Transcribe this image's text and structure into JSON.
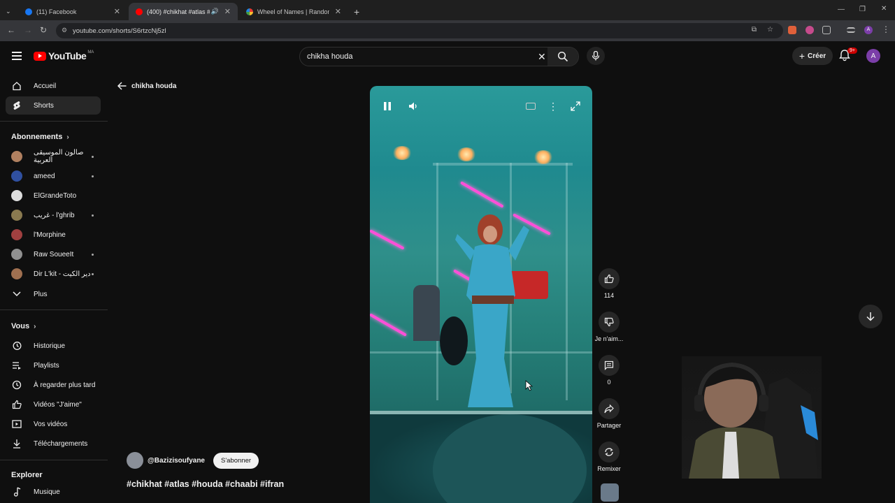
{
  "browser": {
    "tabs": [
      {
        "title": "(11) Facebook",
        "color": "#1877f2",
        "active": false
      },
      {
        "title": "(400) #chikhat #atlas #houd",
        "color": "#ff0000",
        "active": true
      },
      {
        "title": "Wheel of Names | Random nam",
        "color": "#4caf50",
        "active": false
      }
    ],
    "url": "youtube.com/shorts/S6rtzcNj5zl"
  },
  "header": {
    "logo_text": "YouTube",
    "country_code": "MA",
    "search_value": "chikha houda",
    "create_label": "Créer",
    "notif_count": "9+",
    "avatar_letter": "A"
  },
  "sidebar": {
    "main": [
      {
        "label": "Accueil",
        "icon": "home-icon"
      },
      {
        "label": "Shorts",
        "icon": "shorts-icon"
      }
    ],
    "subscriptions_title": "Abonnements",
    "subscriptions": [
      {
        "label": "صالون الموسيقى العربية",
        "color": "#b08060",
        "dot": true
      },
      {
        "label": "ameed",
        "color": "#3050a0",
        "dot": true
      },
      {
        "label": "ElGrandeToto",
        "color": "#dddddd",
        "dot": false
      },
      {
        "label": "غريب - l'ghrib",
        "color": "#8a7a50",
        "dot": true
      },
      {
        "label": "l'Morphine",
        "color": "#a04040",
        "dot": false
      },
      {
        "label": "Raw SoueeIt",
        "color": "#909090",
        "dot": true
      },
      {
        "label": "Dir L'kit - دير الكيت",
        "color": "#a07050",
        "dot": true
      }
    ],
    "more_label": "Plus",
    "you_title": "Vous",
    "you_items": [
      {
        "label": "Historique",
        "icon": "history-icon"
      },
      {
        "label": "Playlists",
        "icon": "playlists-icon"
      },
      {
        "label": "À regarder plus tard",
        "icon": "watch-later-icon"
      },
      {
        "label": "Vidéos \"J'aime\"",
        "icon": "liked-videos-icon"
      },
      {
        "label": "Vos vidéos",
        "icon": "your-videos-icon"
      },
      {
        "label": "Téléchargements",
        "icon": "downloads-icon"
      }
    ],
    "explore_title": "Explorer",
    "explore_items": [
      {
        "label": "Musique",
        "icon": "music-icon"
      }
    ]
  },
  "main": {
    "back_label": "chikha houda",
    "channel_name": "@Bazizisoufyane",
    "subscribe_label": "S'abonner",
    "tags": "#chikhat #atlas #houda #chaabi #ifran"
  },
  "actions": {
    "like_count": "114",
    "dislike_label": "Je n'aim...",
    "comments_count": "0",
    "share_label": "Partager",
    "remix_label": "Remixer"
  }
}
